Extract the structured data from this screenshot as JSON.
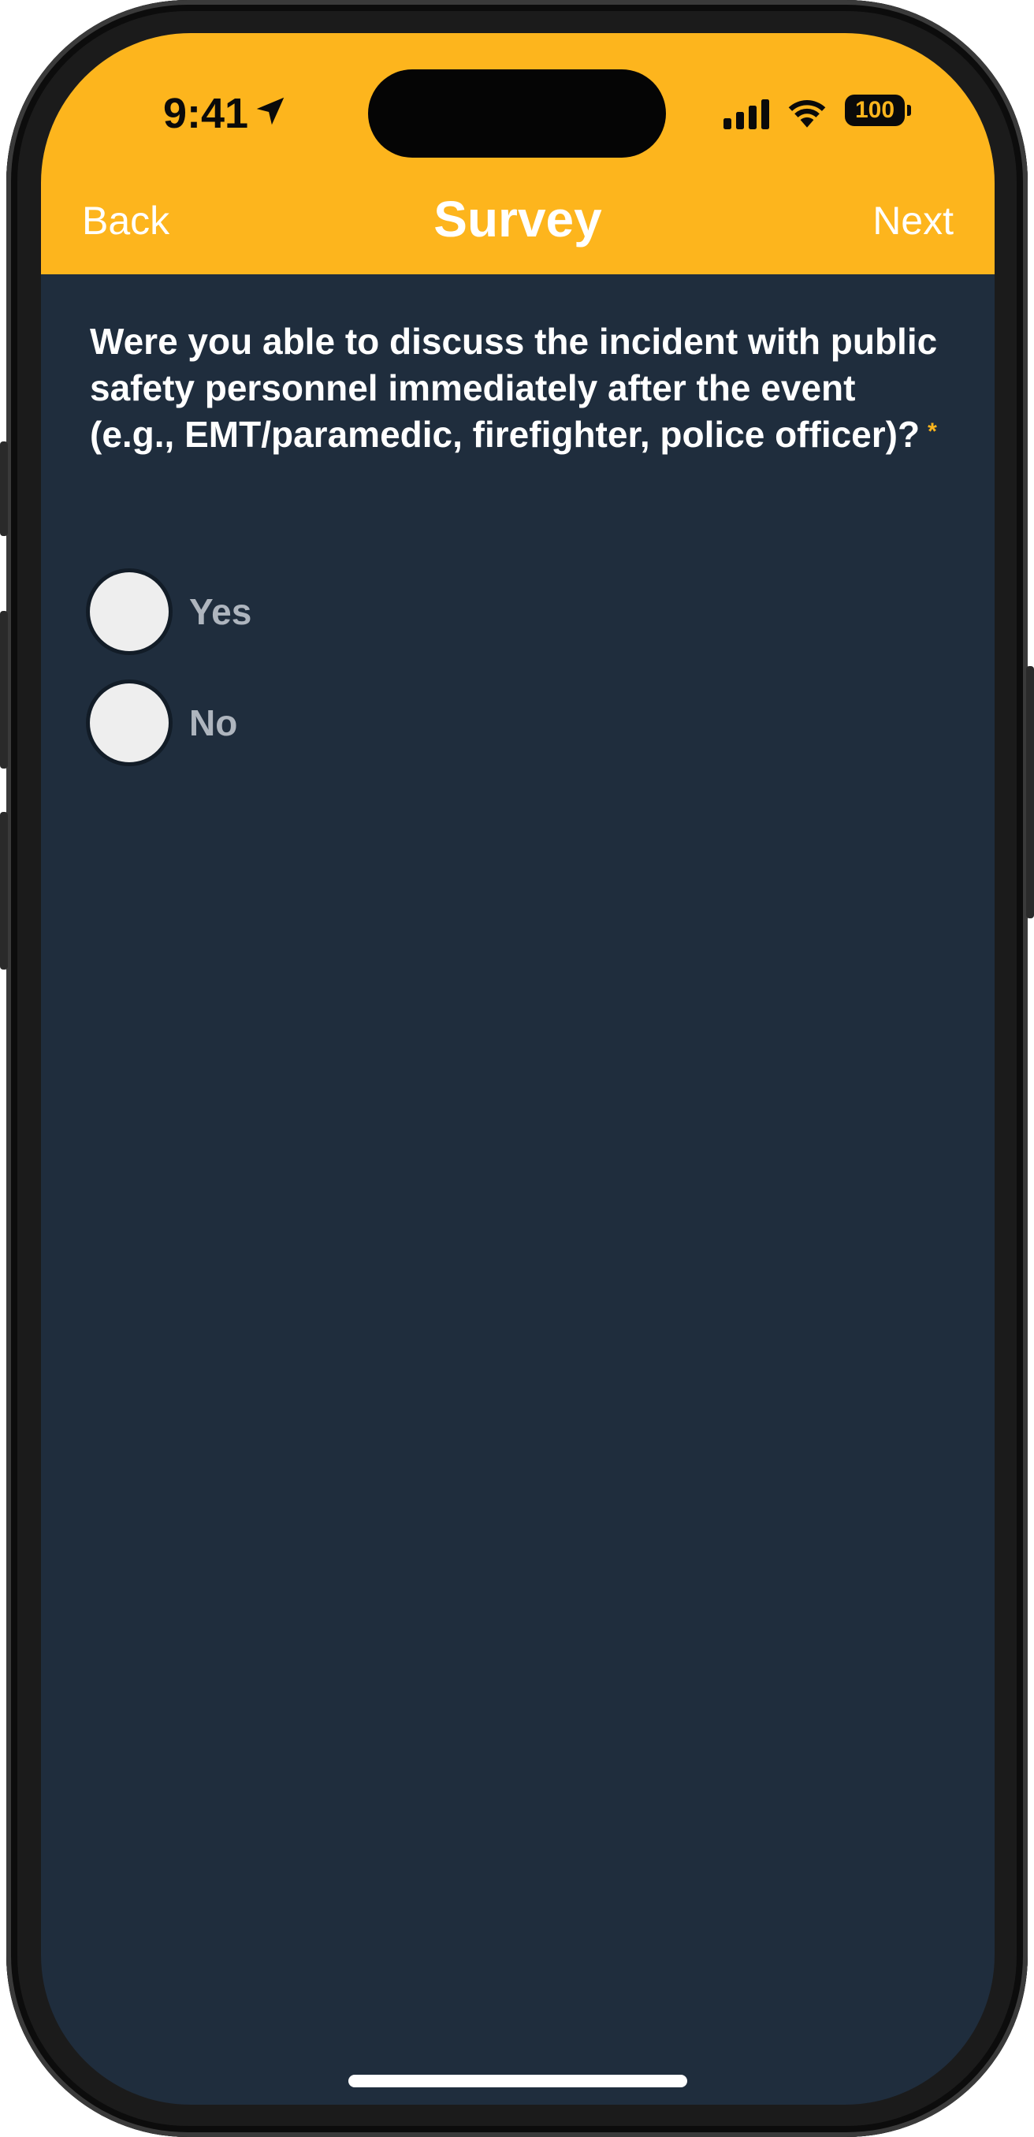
{
  "status_bar": {
    "time": "9:41",
    "battery": "100"
  },
  "nav": {
    "back_label": "Back",
    "title": "Survey",
    "next_label": "Next"
  },
  "survey": {
    "question": "Were you able to discuss the incident with public safety personnel immediately after the event (e.g., EMT/paramedic, firefighter, police officer)?",
    "required_marker": "*",
    "options": [
      {
        "label": "Yes",
        "selected": false
      },
      {
        "label": "No",
        "selected": false
      }
    ]
  },
  "colors": {
    "header": "#fdb51d",
    "background": "#1f2d3d",
    "required_marker": "#fdb51d",
    "option_text": "#aeb5be"
  }
}
